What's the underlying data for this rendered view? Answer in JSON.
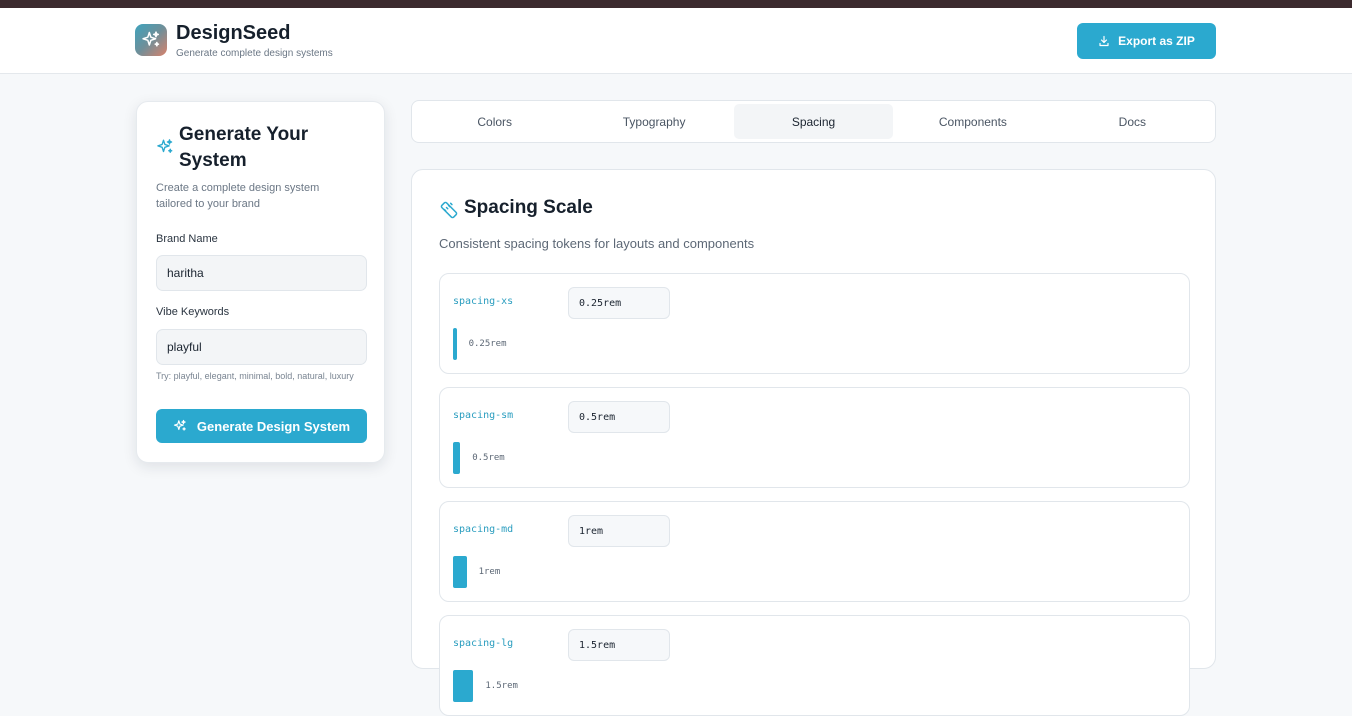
{
  "header": {
    "brand_title": "DesignSeed",
    "brand_subtitle": "Generate complete design systems",
    "export_label": "Export as ZIP"
  },
  "generator": {
    "title": "Generate Your System",
    "description": "Create a complete design system tailored to your brand",
    "brand_label": "Brand Name",
    "brand_value": "haritha",
    "vibe_label": "Vibe Keywords",
    "vibe_value": "playful",
    "hint": "Try: playful, elegant, minimal, bold, natural, luxury",
    "button_label": "Generate Design System"
  },
  "tabs": [
    {
      "label": "Colors"
    },
    {
      "label": "Typography"
    },
    {
      "label": "Spacing",
      "active": true
    },
    {
      "label": "Components"
    },
    {
      "label": "Docs"
    }
  ],
  "spacing": {
    "title": "Spacing Scale",
    "description": "Consistent spacing tokens for layouts and components",
    "tokens": [
      {
        "name": "spacing-xs",
        "value": "0.25rem",
        "rem": 0.25
      },
      {
        "name": "spacing-sm",
        "value": "0.5rem",
        "rem": 0.5
      },
      {
        "name": "spacing-md",
        "value": "1rem",
        "rem": 1
      },
      {
        "name": "spacing-lg",
        "value": "1.5rem",
        "rem": 1.5
      }
    ]
  },
  "colors": {
    "accent": "#2ba9cf",
    "header_strip": "#3c2a2e"
  },
  "icons": {
    "logo": "sparkles-icon",
    "export": "download-icon",
    "generate": "sparkles-icon",
    "spacing": "ruler-icon"
  }
}
